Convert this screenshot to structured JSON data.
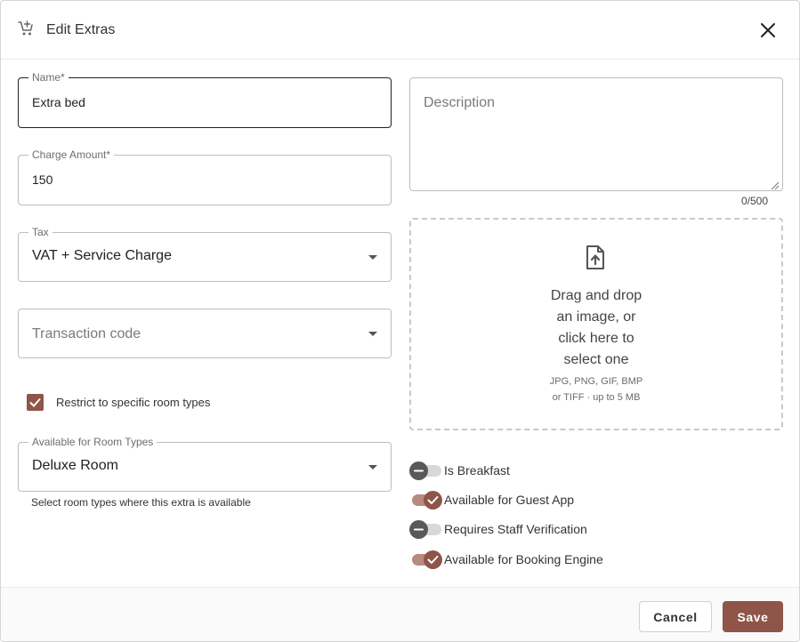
{
  "dialog": {
    "title": "Edit Extras",
    "header_icon": "cart-plus-icon",
    "close_icon": "close-icon"
  },
  "form": {
    "name": {
      "label": "Name*",
      "value": "Extra bed"
    },
    "charge_amount": {
      "label": "Charge Amount*",
      "value": "150"
    },
    "tax": {
      "label": "Tax",
      "value": "VAT + Service Charge"
    },
    "transaction_code": {
      "placeholder": "Transaction code"
    },
    "restrict": {
      "label": "Restrict to specific room types",
      "checked": true
    },
    "room_types": {
      "label": "Available for Room Types",
      "value": "Deluxe Room",
      "helper": "Select room types where this extra is available"
    },
    "description": {
      "placeholder": "Description",
      "counter": "0/500"
    }
  },
  "upload": {
    "icon": "file-upload-icon",
    "lines": [
      "Drag and drop",
      "an image, or",
      "click here to",
      "select one"
    ],
    "hint_1": "JPG, PNG, GIF, BMP",
    "hint_2": "or TIFF · up to 5 MB"
  },
  "toggles": [
    {
      "label": "Is Breakfast",
      "on": false
    },
    {
      "label": "Available for Guest App",
      "on": true
    },
    {
      "label": "Requires Staff Verification",
      "on": false
    },
    {
      "label": "Available for Booking Engine",
      "on": true
    }
  ],
  "footer": {
    "cancel_label": "Cancel",
    "save_label": "Save"
  },
  "colors": {
    "accent": "#8e5548",
    "accent_light": "#b98a80",
    "toggle_off_thumb": "#595959"
  }
}
